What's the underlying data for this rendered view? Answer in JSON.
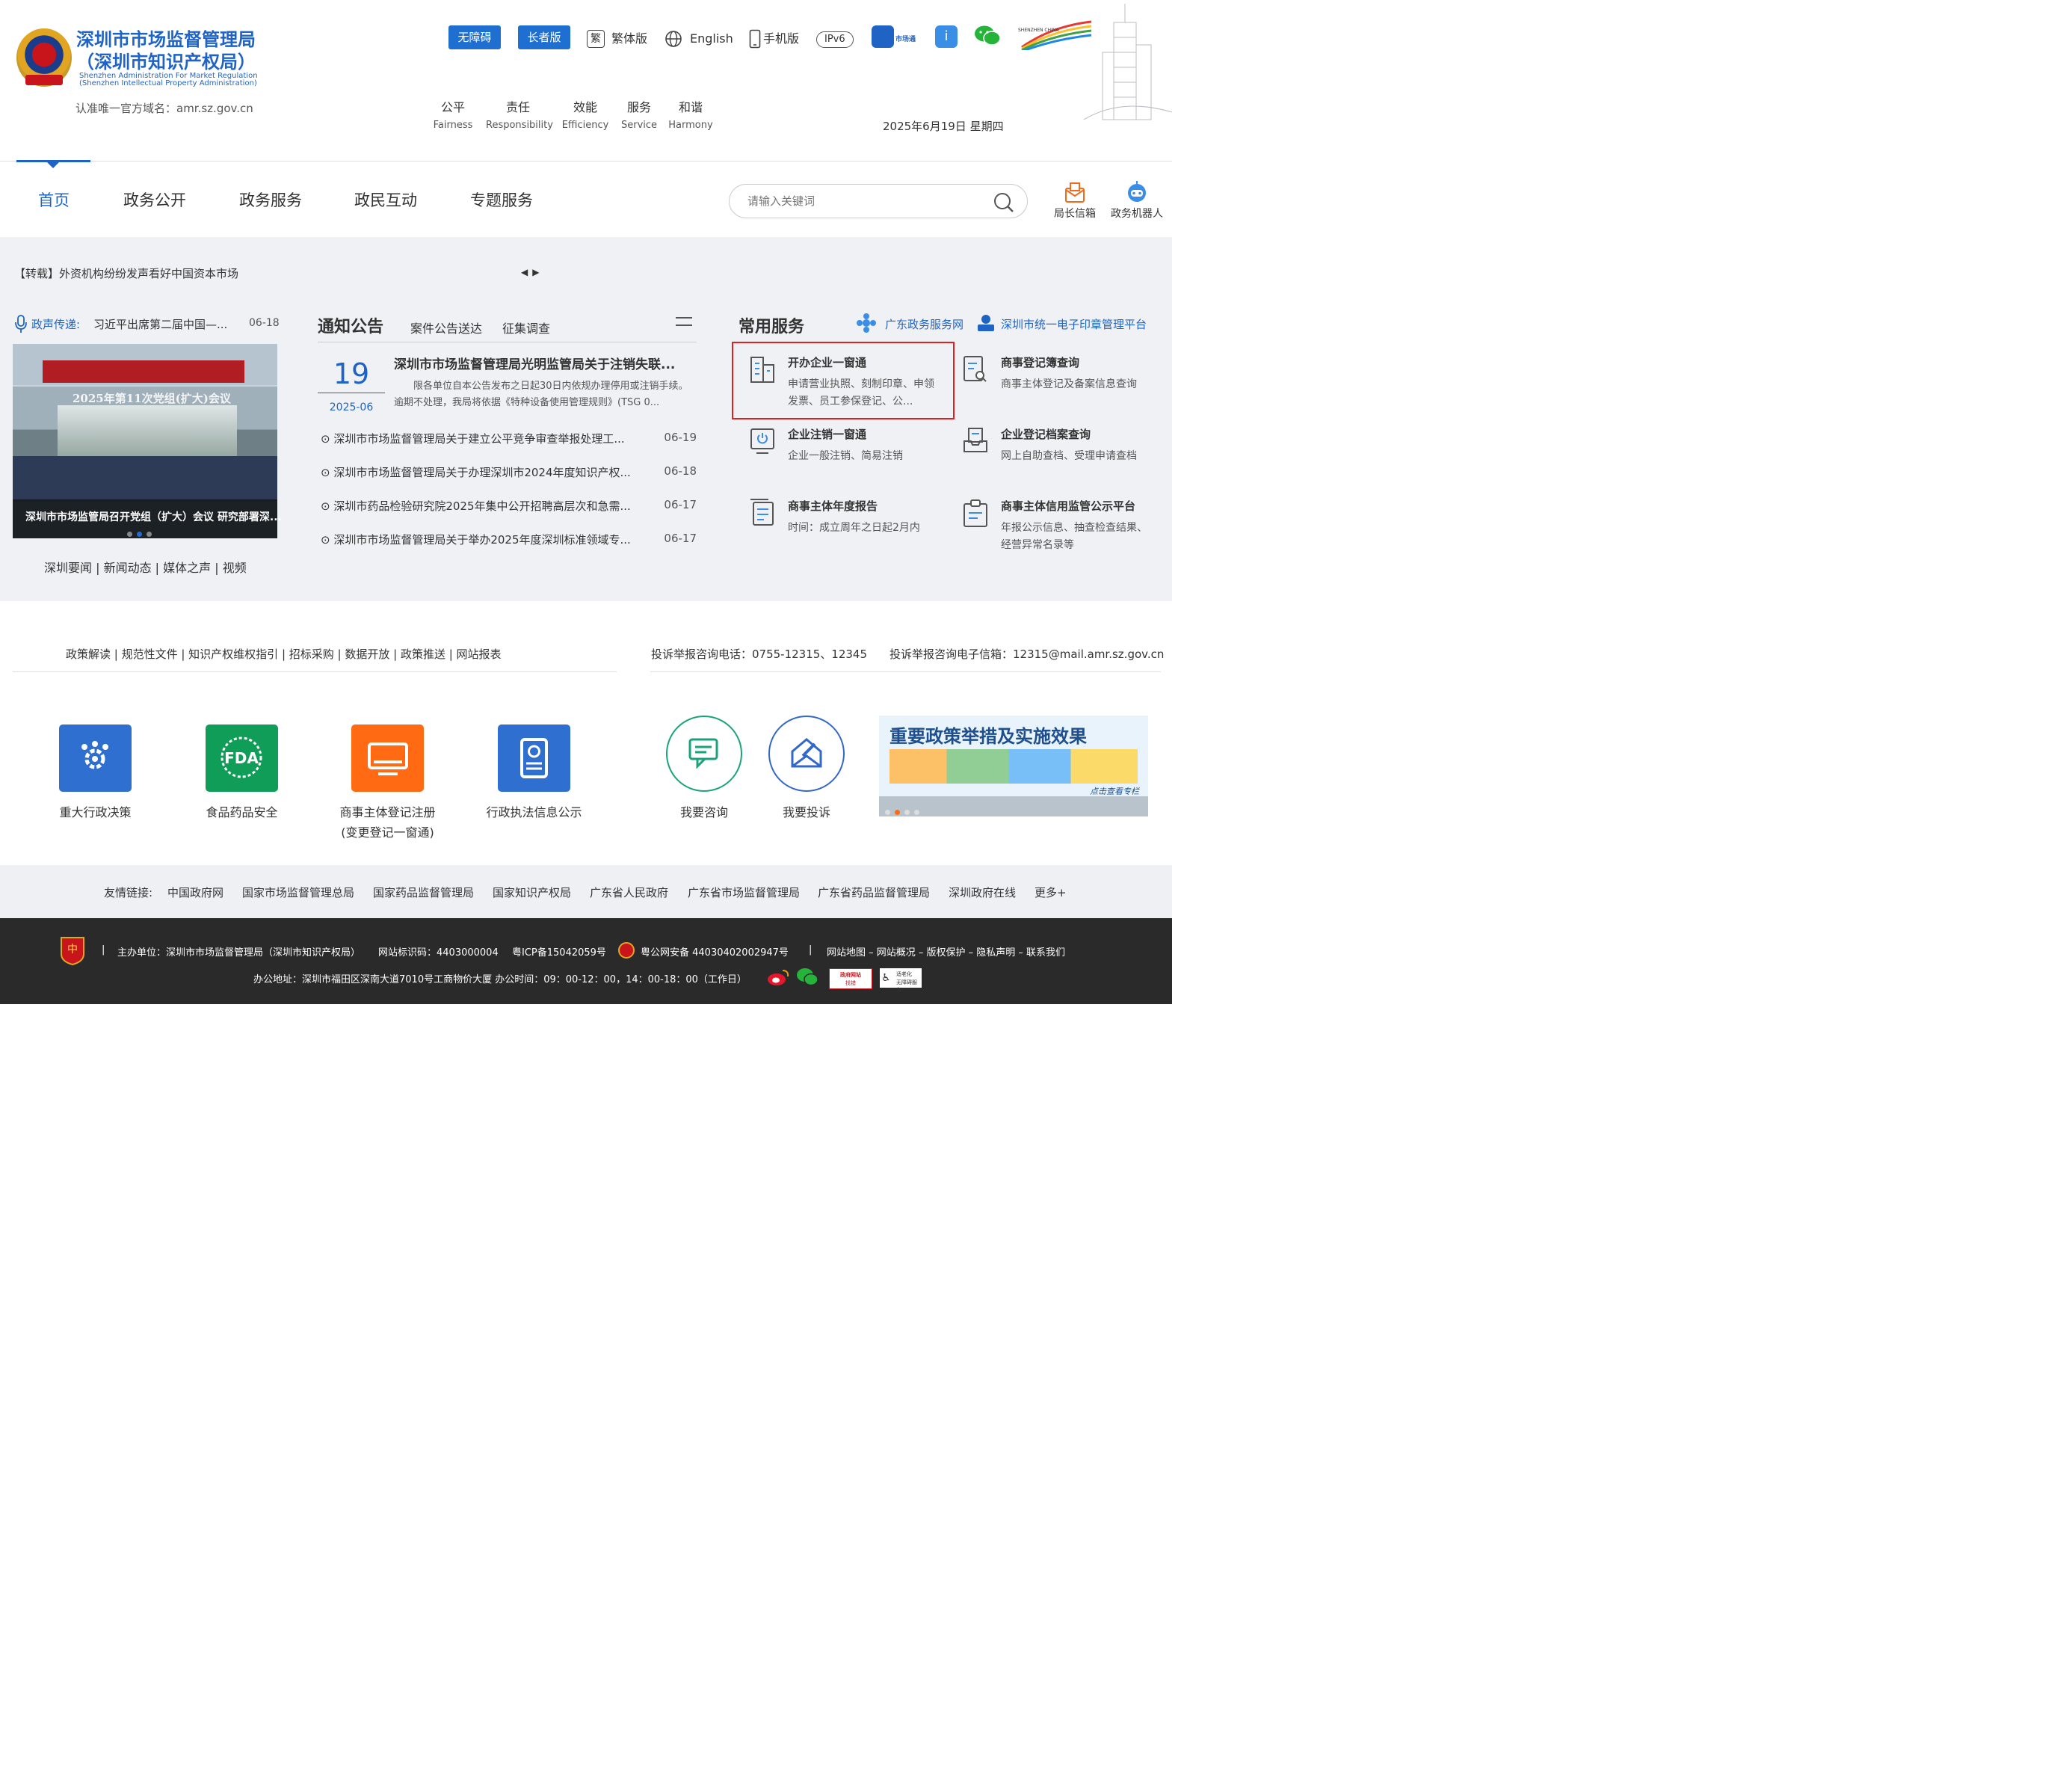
{
  "header": {
    "org_name_line1": "深圳市市场监督管理局",
    "org_name_line2": "（深圳市知识产权局）",
    "org_en_line1": "Shenzhen Administration For Market Regulation",
    "org_en_line2": "(Shenzhen Intellectual Property Administration)",
    "official_domain": "认准唯一官方域名：amr.sz.gov.cn",
    "accessibility_btn": "无障碍",
    "elderly_btn": "长者版",
    "traditional_icon": "繁",
    "traditional_label": "繁体版",
    "english_label": "English",
    "mobile_label": "手机版",
    "ipv6_label": "IPv6",
    "shichangtong_label": "市场通",
    "szgov_en": "SHENZHEN CHINA",
    "values": [
      {
        "cn": "公平",
        "en": "Fairness"
      },
      {
        "cn": "责任",
        "en": "Responsibility"
      },
      {
        "cn": "效能",
        "en": "Efficiency"
      },
      {
        "cn": "服务",
        "en": "Service"
      },
      {
        "cn": "和谐",
        "en": "Harmony"
      }
    ],
    "date": "2025年6月19日 星期四"
  },
  "nav": {
    "items": [
      "首页",
      "政务公开",
      "政务服务",
      "政民互动",
      "专题服务"
    ],
    "search_placeholder": "请输入关键词",
    "director_mailbox": "局长信箱",
    "robot": "政务机器人"
  },
  "ticker": {
    "text": "【转载】外资机构纷纷发声看好中国资本市场"
  },
  "voice": {
    "label": "政声传递:",
    "text": "习近平出席第二届中国—...",
    "date": "06-18"
  },
  "photo": {
    "caption": "深圳市市场监管局召开党组（扩大）会议 研究部署深...",
    "banner_text": "2025年第11次党组(扩大)会议"
  },
  "news_tabs": "深圳要闻 | 新闻动态 | 媒体之声 | 视频",
  "notices": {
    "title": "通知公告",
    "tab2": "案件公告送达",
    "tab3": "征集调查",
    "lead": {
      "day": "19",
      "ym": "2025-06",
      "title": "深圳市市场监督管理局光明监管局关于注销失联...",
      "desc": "限各单位自本公告发布之日起30日内依规办理停用或注销手续。逾期不处理，我局将依据《特种设备使用管理规则》(TSG 0..."
    },
    "rows": [
      {
        "title": "深圳市市场监督管理局关于建立公平竞争审查举报处理工...",
        "date": "06-19"
      },
      {
        "title": "深圳市市场监督管理局关于办理深圳市2024年度知识产权...",
        "date": "06-18"
      },
      {
        "title": "深圳市药品检验研究院2025年集中公开招聘高层次和急需...",
        "date": "06-17"
      },
      {
        "title": "深圳市市场监督管理局关于举办2025年度深圳标准领域专...",
        "date": "06-17"
      }
    ]
  },
  "services": {
    "title": "常用服务",
    "link1": "广东政务服务网",
    "link2": "深圳市统一电子印章管理平台",
    "items": [
      {
        "name": "开办企业一窗通",
        "desc": "申请营业执照、刻制印章、申领发票、员工参保登记、公..."
      },
      {
        "name": "商事登记簿查询",
        "desc": "商事主体登记及备案信息查询"
      },
      {
        "name": "企业注销一窗通",
        "desc": "企业一般注销、简易注销"
      },
      {
        "name": "企业登记档案查询",
        "desc": "网上自助查档、受理申请查档"
      },
      {
        "name": "商事主体年度报告",
        "desc": "时间：成立周年之日起2月内"
      },
      {
        "name": "商事主体信用监管公示平台",
        "desc": "年报公示信息、抽查检查结果、经营异常名录等"
      }
    ]
  },
  "links_bar": "政策解读 | 规范性文件 | 知识产权维权指引 | 招标采购 | 数据开放 | 政策推送 | 网站报表",
  "contact": {
    "phone": "投诉举报咨询电话：0755-12315、12345",
    "email": "投诉举报咨询电子信箱：12315@mail.amr.sz.gov.cn"
  },
  "tiles": [
    {
      "label": "重大行政决策",
      "color": "#2f6fd0"
    },
    {
      "label": "食品药品安全",
      "color": "#0f9d58"
    },
    {
      "label": "商事主体登记注册",
      "label2": "(变更登记一窗通)",
      "color": "#ff6a13"
    },
    {
      "label": "行政执法信息公示",
      "color": "#2f6fd0"
    }
  ],
  "fda_text": "FDA",
  "circles": [
    {
      "label": "我要咨询",
      "color": "#1aa37a"
    },
    {
      "label": "我要投诉",
      "color": "#3468c6"
    }
  ],
  "banner": {
    "title": "重要政策举措及实施效果",
    "sub": "点击查看专栏"
  },
  "friends": {
    "label": "友情链接:",
    "items": [
      "中国政府网",
      "国家市场监督管理总局",
      "国家药品监督管理局",
      "国家知识产权局",
      "广东省人民政府",
      "广东省市场监督管理局",
      "广东省药品监督管理局",
      "深圳政府在线",
      "更多+"
    ]
  },
  "footer": {
    "host": "主办单位：深圳市市场监督管理局（深圳市知识产权局）",
    "site_code": "网站标识码：4403000004",
    "icp": "粤ICP备15042059号",
    "police": "粤公网安备 44030402002947号",
    "links": "网站地图 – 网站概况 – 版权保护 – 隐私声明 – 联系我们",
    "address": "办公地址：深圳市福田区深南大道7010号工商物价大厦 办公时间：09：00-12：00，14：00-18：00（工作日）",
    "badge1": "政府网站",
    "badge1b": "找错",
    "badge2": "适老化",
    "badge2b": "无障碍服务"
  }
}
